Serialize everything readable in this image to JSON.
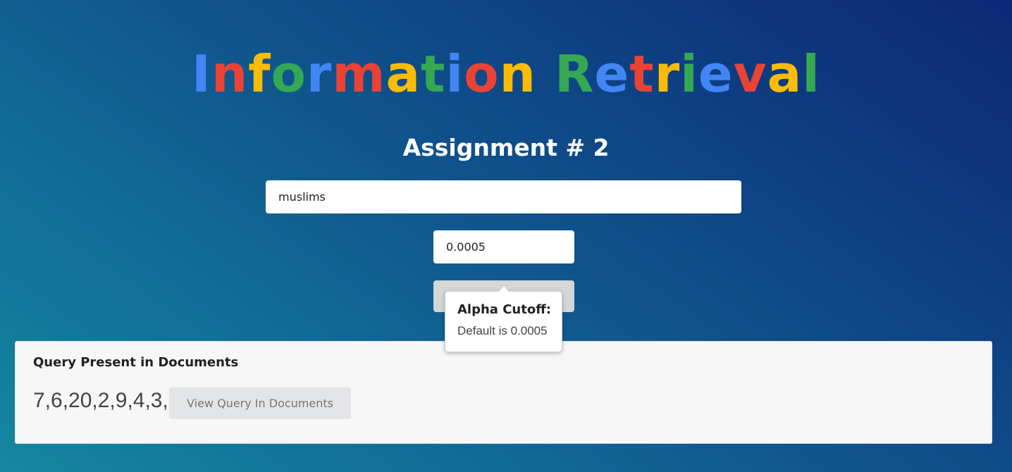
{
  "header": {
    "title": "Information Retrieval",
    "title_colors": [
      "#4285f4",
      "#ea4335",
      "#fbbc05",
      "#34a853"
    ],
    "subtitle": "Assignment # 2"
  },
  "form": {
    "query_value": "muslims",
    "alpha_value": "0.0005",
    "submit_label": ""
  },
  "popover": {
    "title": "Alpha Cutoff:",
    "body": "Default is 0.0005"
  },
  "results": {
    "heading": "Query Present in Documents",
    "document_ids": "7,6,20,2,9,4,3,",
    "view_button_label": "View Query In Documents"
  }
}
